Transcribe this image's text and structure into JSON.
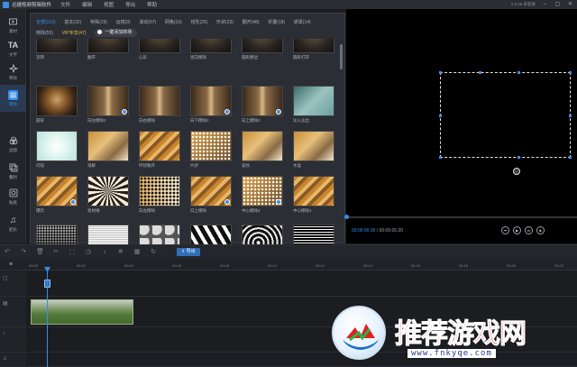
{
  "app": {
    "title": "迅捷视频剪辑软件"
  },
  "menu": [
    "文件",
    "编辑",
    "视图",
    "导出",
    "帮助"
  ],
  "titlebar": {
    "status_text": "1.0.46 未登录"
  },
  "leftnav": [
    {
      "label": "素材",
      "icon": "folder-icon"
    },
    {
      "label": "文字",
      "icon": "text-icon"
    },
    {
      "label": "特效",
      "icon": "sparkle-icon"
    },
    {
      "label": "转场",
      "icon": "transition-icon",
      "active": true
    },
    {
      "label": "滤镜",
      "icon": "filter-icon"
    },
    {
      "label": "叠附",
      "icon": "overlay-icon"
    },
    {
      "label": "贴纸",
      "icon": "sticker-icon"
    },
    {
      "label": "配乐",
      "icon": "music-icon"
    }
  ],
  "categories": [
    {
      "label": "全部(213)",
      "active": true
    },
    {
      "label": "基本(32)"
    },
    {
      "label": "特殊(19)"
    },
    {
      "label": "运镜(9)"
    },
    {
      "label": "滚动(57)"
    },
    {
      "label": "网格(16)"
    },
    {
      "label": "线性(26)"
    },
    {
      "label": "形状(23)"
    },
    {
      "label": "翻开(48)"
    },
    {
      "label": "折叠(18)"
    },
    {
      "label": "遮罩(14)"
    },
    {
      "label": "擦除(55)"
    },
    {
      "label": "VIP专享(47)",
      "vip": true
    }
  ],
  "apply_all_label": "一键添加转场",
  "transitions": [
    {
      "name": "流转",
      "style": "t-dark",
      "badge": false
    },
    {
      "name": "翻开",
      "style": "t-dark",
      "badge": false
    },
    {
      "name": "心形",
      "style": "t-dark",
      "badge": false
    },
    {
      "name": "径向擦除",
      "style": "t-dark",
      "badge": false
    },
    {
      "name": "圆形擦边",
      "style": "t-dark",
      "badge": false
    },
    {
      "name": "圆形打开",
      "style": "t-dark",
      "badge": false
    },
    {
      "name": "圆形",
      "style": "t-fish",
      "badge": false
    },
    {
      "name": "向左擦除2",
      "style": "t-street",
      "badge": true
    },
    {
      "name": "向右擦除",
      "style": "t-street",
      "badge": false
    },
    {
      "name": "向下擦除2",
      "style": "t-street",
      "badge": true
    },
    {
      "name": "向上擦除2",
      "style": "t-street",
      "badge": true
    },
    {
      "name": "淡入淡出",
      "style": "t-teal",
      "badge": false
    },
    {
      "name": "闪现",
      "style": "t-flash",
      "badge": false
    },
    {
      "name": "溶解",
      "style": "t-cat",
      "badge": false
    },
    {
      "name": "环状散开",
      "style": "t-amber",
      "badge": false
    },
    {
      "name": "片状",
      "style": "t-halftone",
      "badge": false
    },
    {
      "name": "波纹",
      "style": "t-cat",
      "badge": false
    },
    {
      "name": "水晶",
      "style": "t-cat",
      "badge": false
    },
    {
      "name": "爆炸",
      "style": "t-amber",
      "badge": true
    },
    {
      "name": "星射线",
      "style": "t-burst",
      "badge": false
    },
    {
      "name": "向左擦除",
      "style": "t-halftone2",
      "badge": false
    },
    {
      "name": "向上擦除",
      "style": "t-amber",
      "badge": true
    },
    {
      "name": "中心擦除2",
      "style": "t-halftone",
      "badge": true
    },
    {
      "name": "中心擦除1",
      "style": "t-amber",
      "badge": false
    },
    {
      "name": "",
      "style": "t-grad",
      "badge": false
    },
    {
      "name": "",
      "style": "t-hgrad",
      "badge": false
    },
    {
      "name": "",
      "style": "t-circles",
      "badge": false
    },
    {
      "name": "",
      "style": "t-bw",
      "badge": false
    },
    {
      "name": "",
      "style": "t-swirl",
      "badge": false
    },
    {
      "name": "",
      "style": "t-noise",
      "badge": false
    }
  ],
  "preview": {
    "current_time": "00:00:00.00",
    "total_time": "00:00:05.00",
    "progress": 0.0
  },
  "controls": [
    "prev-icon",
    "play-icon",
    "next-icon",
    "stop-icon"
  ],
  "toolbar": {
    "export_label": "导出"
  },
  "ruler_ticks": [
    "00:00",
    "00:02",
    "00:04",
    "00:06",
    "00:08",
    "00:10",
    "00:12",
    "00:14",
    "00:16",
    "00:18",
    "00:20",
    "00:22"
  ],
  "watermark": {
    "text": "推荐游戏网",
    "url": "www.fnkyqe.com"
  }
}
